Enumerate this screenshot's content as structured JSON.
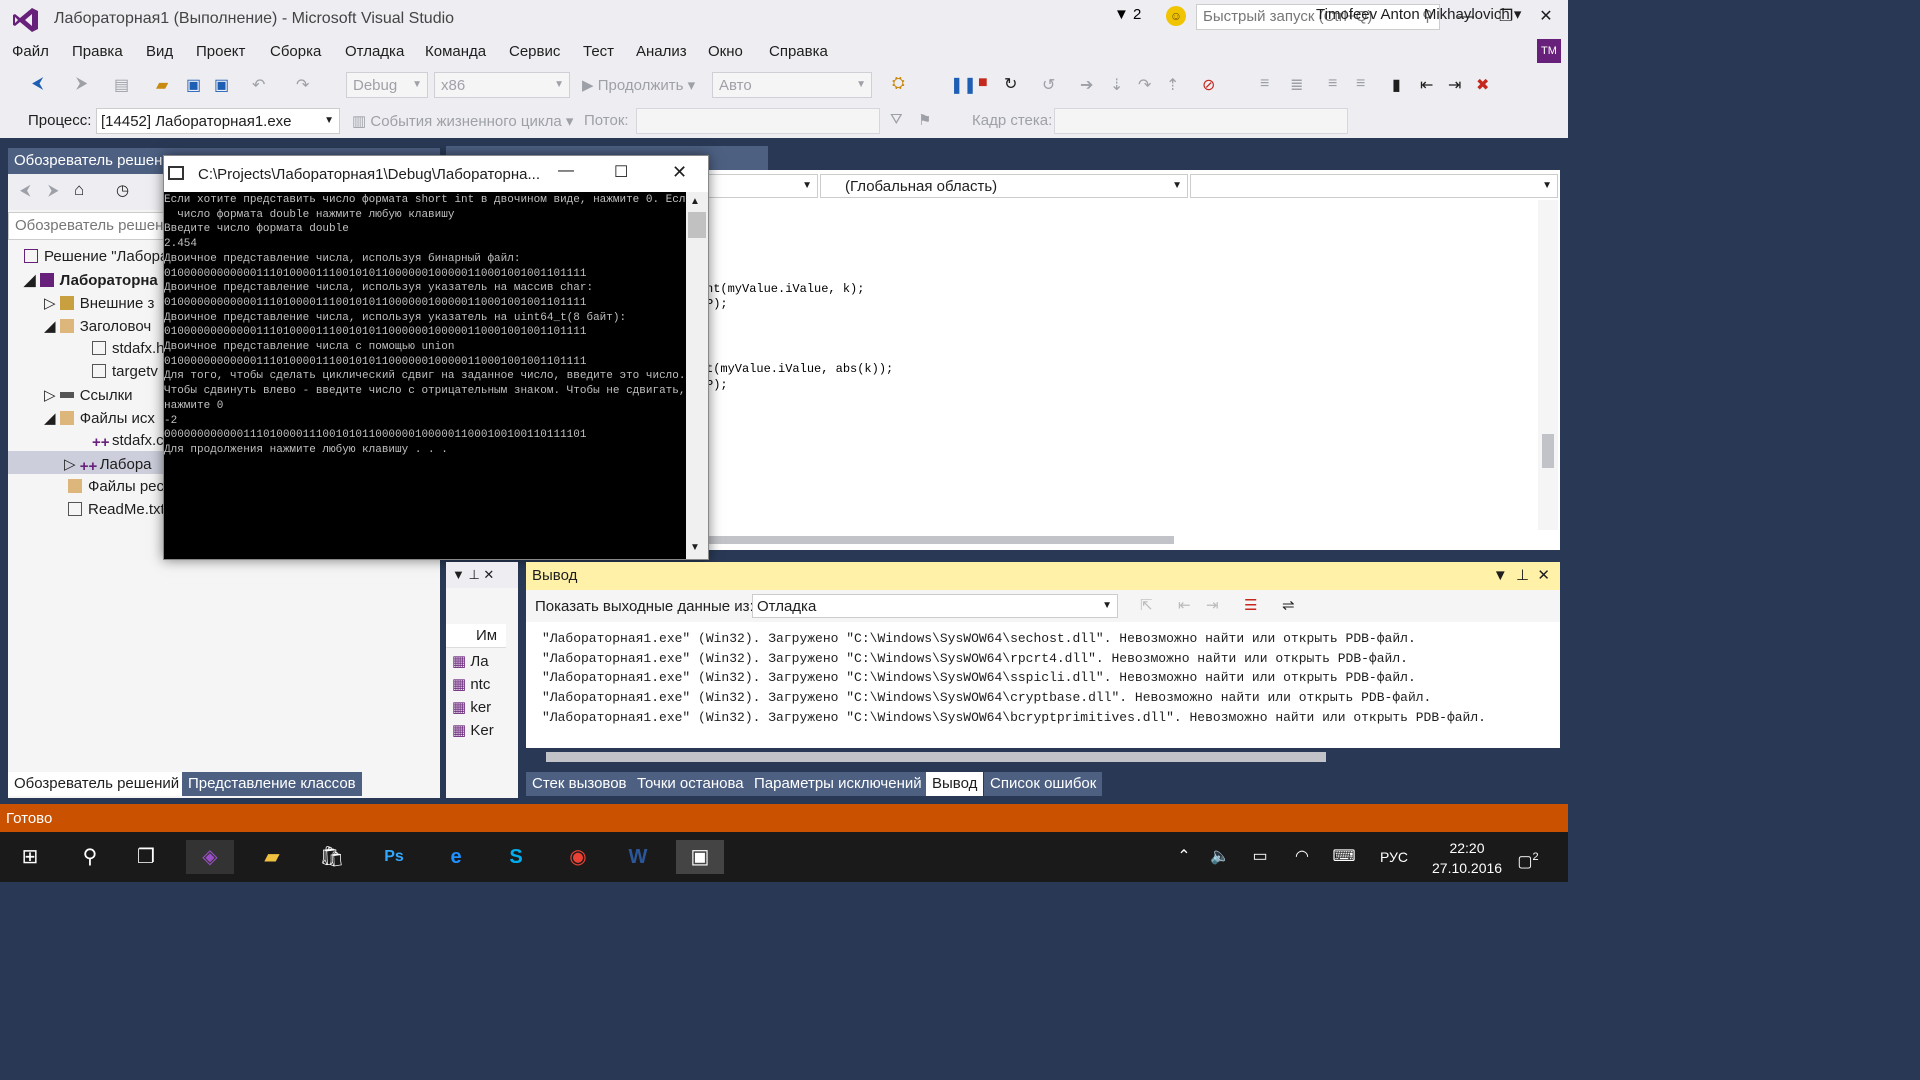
{
  "window": {
    "title": "Лабораторная1 (Выполнение) - Microsoft Visual Studio",
    "notifications": "2",
    "quick_launch": "Быстрый запуск (Ctrl+Q)",
    "user": "Timofeev Anton Mikhaylovich",
    "avatar": "TM"
  },
  "menu": [
    "Файл",
    "Правка",
    "Вид",
    "Проект",
    "Сборка",
    "Отладка",
    "Команда",
    "Сервис",
    "Тест",
    "Анализ",
    "Окно",
    "Справка"
  ],
  "toolbar": {
    "config": "Debug",
    "platform": "x86",
    "continue": "Продолжить",
    "auto": "Авто"
  },
  "debug_bar": {
    "process_label": "Процесс:",
    "process": "[14452] Лабораторная1.exe",
    "lifecycle": "События жизненного цикла",
    "thread_label": "Поток:",
    "stack_label": "Кадр стека:"
  },
  "solution_explorer": {
    "title": "Обозреватель решени",
    "search": "Обозреватель решени",
    "items": [
      "Решение \"Лабора",
      "Лабораторна",
      "Внешние з",
      "Заголовоч",
      "stdafx.h",
      "targetv",
      "Ссылки",
      "Файлы исх",
      "stdafx.c",
      "Лабора",
      "Файлы рес",
      "ReadMe.txt"
    ],
    "tabs": [
      "Обозреватель решений",
      "Представление классов"
    ]
  },
  "editor": {
    "scope": "(Глобальная область)",
    "code": [
      "nt(myValue.iValue, k);",
      "P);",
      "t(myValue.iValue, abs(k));",
      "P);"
    ]
  },
  "console": {
    "title": "C:\\Projects\\Лабораторная1\\Debug\\Лабораторна...",
    "lines": [
      "Если хотите представить число формата short int в двочином виде, нажмите 0. Если",
      "  число формата double нажмите любую клавишу",
      "Введите число формата double",
      "2.454",
      "Двоичное представление числа, используя бинарный файл:",
      "0100000000000011101000011100101011000000100000110001001001101111",
      "Двоичное представление числа, используя указатель на массив char:",
      "0100000000000011101000011100101011000000100000110001001001101111",
      "Двоичное представление числа, используя указатель на uint64_t(8 байт):",
      "0100000000000011101000011100101011000000100000110001001001101111",
      "Двоичное представление числа с помощью union",
      "0100000000000011101000011100101011000000100000110001001001101111",
      "Для того, чтобы сделать циклический сдвиг на заданное число, введите это число.",
      "Чтобы сдвинуть влево - введите число с отрицательным знаком. Чтобы не сдвигать,",
      "нажмите 0",
      "-2",
      "0000000000001110100001110010101100000010000011000100100110111101",
      "Для продолжения нажмите любую клавишу . . ."
    ]
  },
  "locals": {
    "header": "Им",
    "rows": [
      "Ла",
      "ntc",
      "ker",
      "Ker"
    ]
  },
  "output": {
    "title": "Вывод",
    "show_label": "Показать выходные данные из:",
    "source": "Отладка",
    "lines": [
      "\"Лабораторная1.exe\" (Win32). Загружено \"C:\\Windows\\SysWOW64\\sechost.dll\". Невозможно найти или открыть PDB-файл.",
      "\"Лабораторная1.exe\" (Win32). Загружено \"C:\\Windows\\SysWOW64\\rpcrt4.dll\". Невозможно найти или открыть PDB-файл.",
      "\"Лабораторная1.exe\" (Win32). Загружено \"C:\\Windows\\SysWOW64\\sspicli.dll\". Невозможно найти или открыть PDB-файл.",
      "\"Лабораторная1.exe\" (Win32). Загружено \"C:\\Windows\\SysWOW64\\cryptbase.dll\". Невозможно найти или открыть PDB-файл.",
      "\"Лабораторная1.exe\" (Win32). Загружено \"C:\\Windows\\SysWOW64\\bcryptprimitives.dll\". Невозможно найти или открыть PDB-файл."
    ],
    "tabs": [
      "Стек вызовов",
      "Точки останова",
      "Параметры исключений",
      "Вывод",
      "Список ошибок"
    ]
  },
  "status": "Готово",
  "taskbar": {
    "lang": "РУС",
    "time": "22:20",
    "date": "27.10.2016",
    "action_center": "2"
  }
}
